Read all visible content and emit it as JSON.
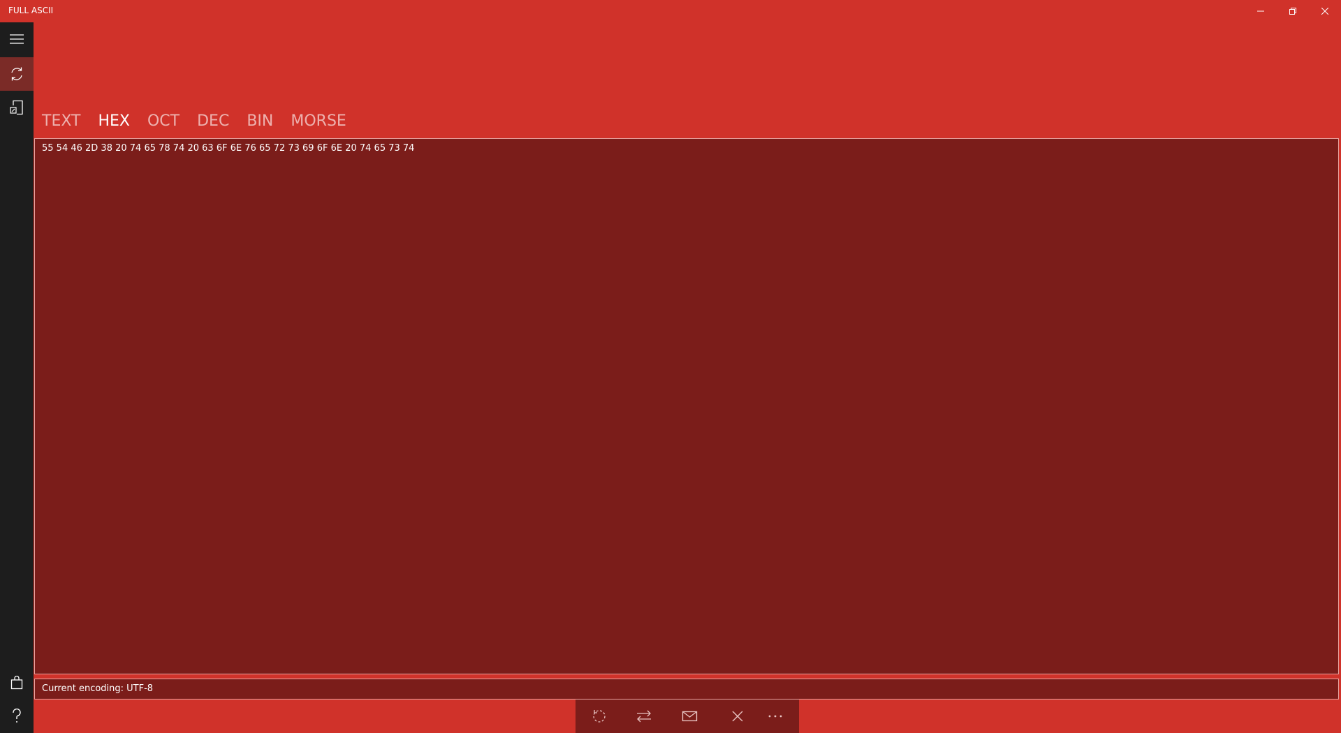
{
  "window": {
    "title": "FULL ASCII"
  },
  "tabs": [
    {
      "label": "TEXT",
      "selected": false
    },
    {
      "label": "HEX",
      "selected": true
    },
    {
      "label": "OCT",
      "selected": false
    },
    {
      "label": "DEC",
      "selected": false
    },
    {
      "label": "BIN",
      "selected": false
    },
    {
      "label": "MORSE",
      "selected": false
    }
  ],
  "main": {
    "content": "55 54 46 2D 38 20 74 65 78 74 20 63 6F 6E 76 65 72 73 69 6F 6E 20 74 65 73 74"
  },
  "status": {
    "encoding": "Current encoding: UTF-8"
  },
  "nav": {
    "items": [
      {
        "icon": "hamburger-menu-icon",
        "active": false
      },
      {
        "icon": "convert-sync-icon",
        "active": true
      },
      {
        "icon": "document-icon",
        "active": false
      },
      {
        "icon": "store-bag-icon",
        "active": false
      },
      {
        "icon": "help-icon",
        "active": false
      }
    ]
  },
  "commands": {
    "icons": [
      "rotate-dashed-icon",
      "swap-arrows-icon",
      "mail-icon",
      "close-icon",
      "more-icon"
    ]
  },
  "colors": {
    "background": "#d0322a",
    "panel": "#7b1d1a",
    "rail": "#1d1d1d",
    "rail_active": "#7b2b27",
    "border": "#e7a5a1"
  }
}
